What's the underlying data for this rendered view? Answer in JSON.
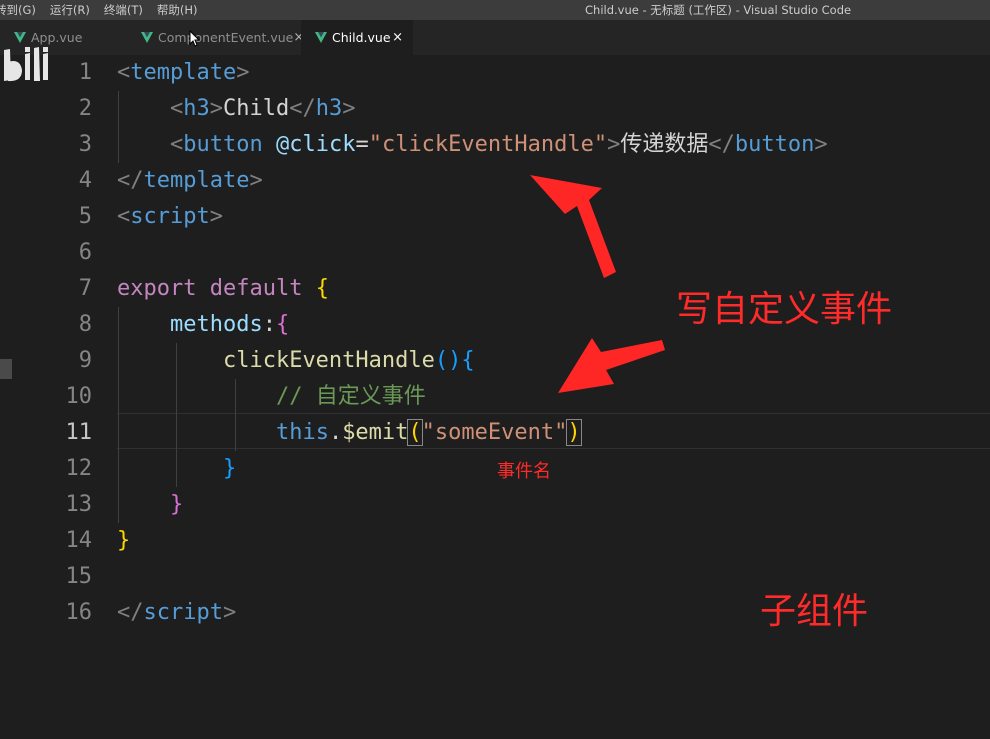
{
  "menu": [
    "转到(G)",
    "运行(R)",
    "终端(T)",
    "帮助(H)"
  ],
  "window_title": "Child.vue - 无标题 (工作区) - Visual Studio Code",
  "tabs": [
    {
      "label": "App.vue",
      "close": ""
    },
    {
      "label": "ComponentEvent.vue",
      "close": "×"
    },
    {
      "label": "Child.vue",
      "close": "×"
    }
  ],
  "line_numbers": [
    "1",
    "2",
    "3",
    "4",
    "5",
    "6",
    "7",
    "8",
    "9",
    "10",
    "11",
    "12",
    "13",
    "14",
    "15",
    "16"
  ],
  "code": {
    "template_open": "template",
    "h3": "h3",
    "h3_text": "Child",
    "button": "button",
    "click_attr": "@click",
    "handler": "\"clickEventHandle\"",
    "button_text": "传递数据",
    "script": "script",
    "export": "export",
    "default": "default",
    "methods": "methods",
    "fn_name": "clickEventHandle",
    "comment": "// 自定义事件",
    "this": "this",
    "emit": "$emit",
    "event_name": "\"someEvent\""
  },
  "annotations": {
    "custom_event": "写自定义事件",
    "event_name": "事件名",
    "child_component": "子组件"
  },
  "logo_text": "bili",
  "colors": {
    "vue_green": "#42b883",
    "annotation_red": "#ff2a2a"
  }
}
